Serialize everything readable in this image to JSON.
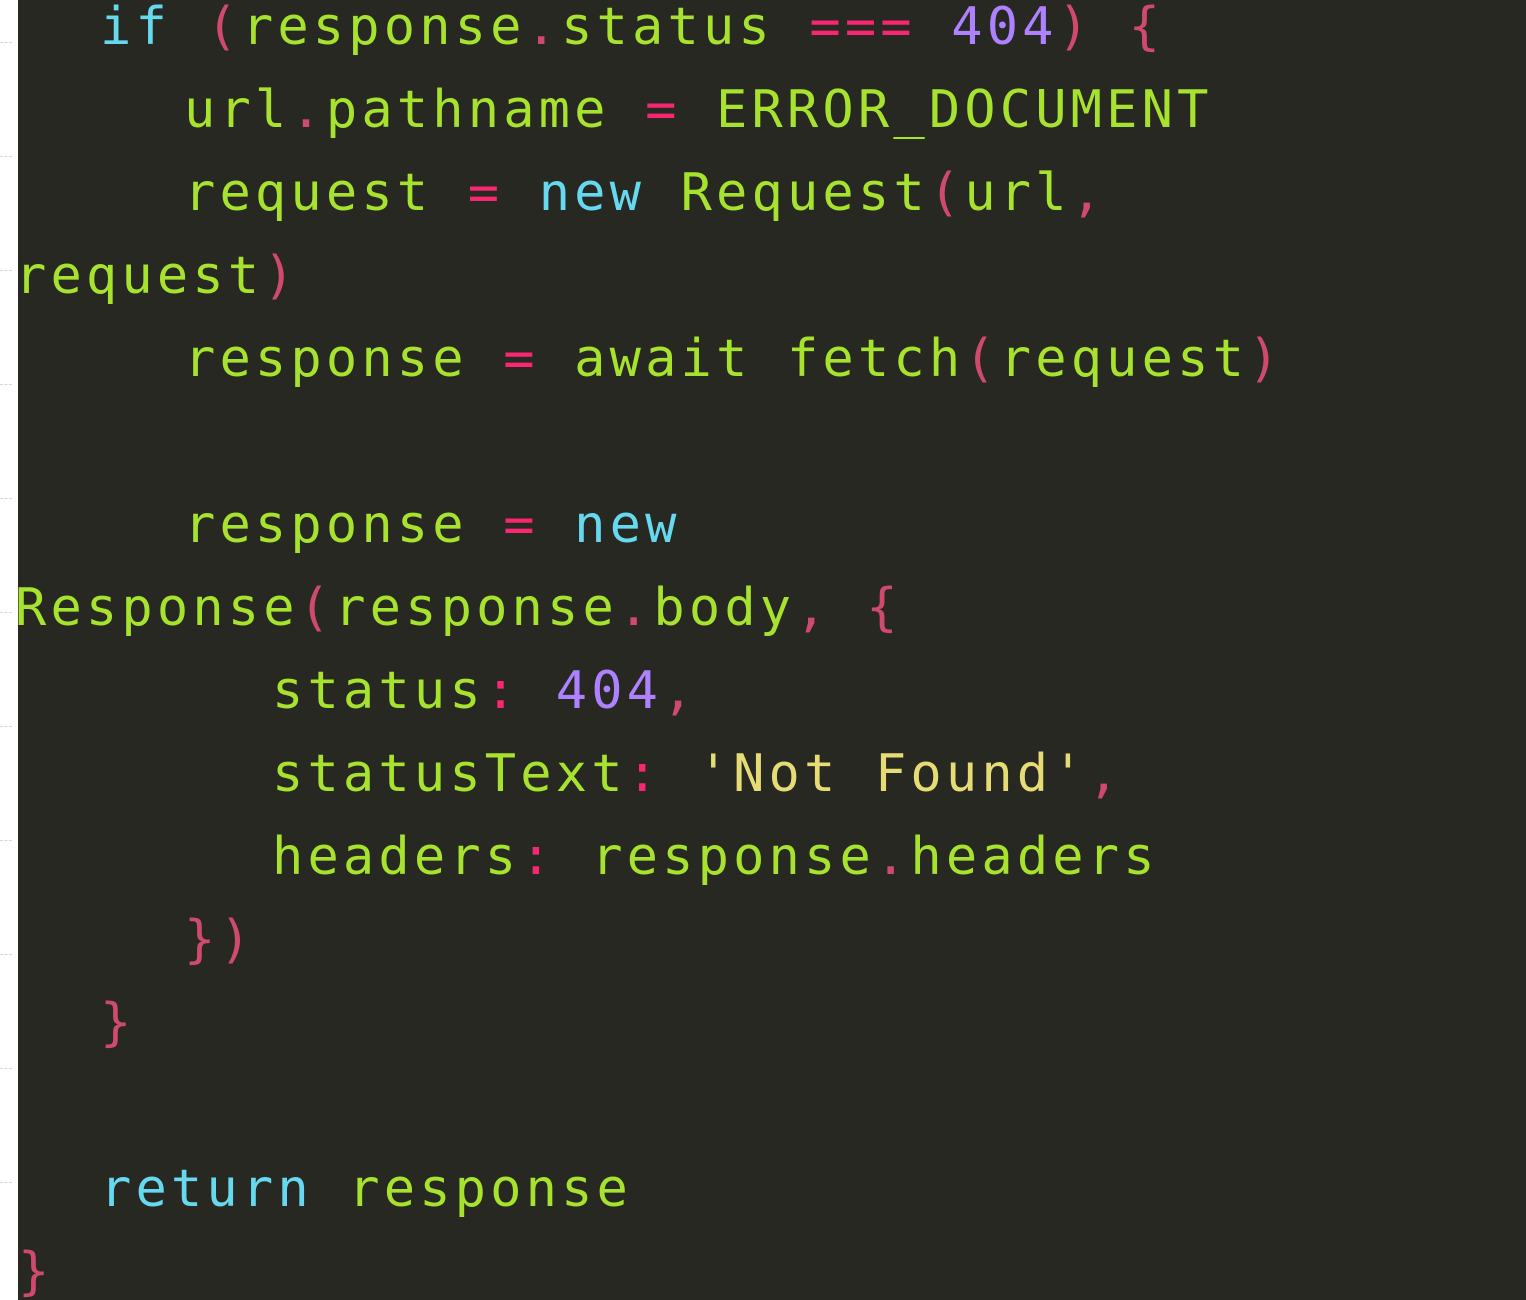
{
  "editor": {
    "theme_colors": {
      "background": "#272822",
      "keyword": "#66d9ef",
      "identifier": "#a6e22e",
      "operator": "#f92672",
      "number": "#ae81ff",
      "string": "#e6db74"
    },
    "lines": [
      {
        "tokens": [
          {
            "t": "kw",
            "v": "if"
          },
          {
            "t": "sp",
            "v": " "
          },
          {
            "t": "punc",
            "v": "("
          },
          {
            "t": "id",
            "v": "response"
          },
          {
            "t": "punc",
            "v": "."
          },
          {
            "t": "id",
            "v": "status"
          },
          {
            "t": "sp",
            "v": " "
          },
          {
            "t": "op",
            "v": "==="
          },
          {
            "t": "sp",
            "v": " "
          },
          {
            "t": "num",
            "v": "404"
          },
          {
            "t": "punc",
            "v": ")"
          },
          {
            "t": "sp",
            "v": " "
          },
          {
            "t": "punc",
            "v": "{"
          }
        ]
      },
      {
        "tokens": [
          {
            "t": "id",
            "v": "url"
          },
          {
            "t": "punc",
            "v": "."
          },
          {
            "t": "id",
            "v": "pathname"
          },
          {
            "t": "sp",
            "v": " "
          },
          {
            "t": "op",
            "v": "="
          },
          {
            "t": "sp",
            "v": " "
          },
          {
            "t": "const",
            "v": "ERROR_DOCUMENT"
          }
        ]
      },
      {
        "tokens": [
          {
            "t": "id",
            "v": "request"
          },
          {
            "t": "sp",
            "v": " "
          },
          {
            "t": "op",
            "v": "="
          },
          {
            "t": "sp",
            "v": " "
          },
          {
            "t": "kw",
            "v": "new"
          },
          {
            "t": "sp",
            "v": " "
          },
          {
            "t": "id",
            "v": "Request"
          },
          {
            "t": "punc",
            "v": "("
          },
          {
            "t": "id",
            "v": "url"
          },
          {
            "t": "punc",
            "v": ","
          }
        ]
      },
      {
        "tokens": [
          {
            "t": "id",
            "v": "request"
          },
          {
            "t": "punc",
            "v": ")"
          }
        ]
      },
      {
        "tokens": [
          {
            "t": "id",
            "v": "response"
          },
          {
            "t": "sp",
            "v": " "
          },
          {
            "t": "op",
            "v": "="
          },
          {
            "t": "sp",
            "v": " "
          },
          {
            "t": "id",
            "v": "await"
          },
          {
            "t": "sp",
            "v": " "
          },
          {
            "t": "id",
            "v": "fetch"
          },
          {
            "t": "punc",
            "v": "("
          },
          {
            "t": "id",
            "v": "request"
          },
          {
            "t": "punc",
            "v": ")"
          }
        ]
      },
      {
        "tokens": []
      },
      {
        "tokens": [
          {
            "t": "id",
            "v": "response"
          },
          {
            "t": "sp",
            "v": " "
          },
          {
            "t": "op",
            "v": "="
          },
          {
            "t": "sp",
            "v": " "
          },
          {
            "t": "kw",
            "v": "new"
          }
        ]
      },
      {
        "tokens": [
          {
            "t": "id",
            "v": "Response"
          },
          {
            "t": "punc",
            "v": "("
          },
          {
            "t": "id",
            "v": "response"
          },
          {
            "t": "punc",
            "v": "."
          },
          {
            "t": "id",
            "v": "body"
          },
          {
            "t": "punc",
            "v": ","
          },
          {
            "t": "sp",
            "v": " "
          },
          {
            "t": "punc",
            "v": "{"
          }
        ]
      },
      {
        "tokens": [
          {
            "t": "id",
            "v": "status"
          },
          {
            "t": "op",
            "v": ":"
          },
          {
            "t": "sp",
            "v": " "
          },
          {
            "t": "num",
            "v": "404"
          },
          {
            "t": "punc",
            "v": ","
          }
        ]
      },
      {
        "tokens": [
          {
            "t": "id",
            "v": "statusText"
          },
          {
            "t": "op",
            "v": ":"
          },
          {
            "t": "sp",
            "v": " "
          },
          {
            "t": "str",
            "v": "'Not Found'"
          },
          {
            "t": "punc",
            "v": ","
          }
        ]
      },
      {
        "tokens": [
          {
            "t": "id",
            "v": "headers"
          },
          {
            "t": "op",
            "v": ":"
          },
          {
            "t": "sp",
            "v": " "
          },
          {
            "t": "id",
            "v": "response"
          },
          {
            "t": "punc",
            "v": "."
          },
          {
            "t": "id",
            "v": "headers"
          }
        ]
      },
      {
        "tokens": [
          {
            "t": "punc",
            "v": "})"
          }
        ]
      },
      {
        "tokens": [
          {
            "t": "punc",
            "v": "}"
          }
        ]
      },
      {
        "tokens": []
      },
      {
        "tokens": [
          {
            "t": "kw",
            "v": "return"
          },
          {
            "t": "sp",
            "v": " "
          },
          {
            "t": "id",
            "v": "response"
          }
        ]
      },
      {
        "tokens": [
          {
            "t": "punc",
            "v": "}"
          }
        ]
      }
    ]
  }
}
